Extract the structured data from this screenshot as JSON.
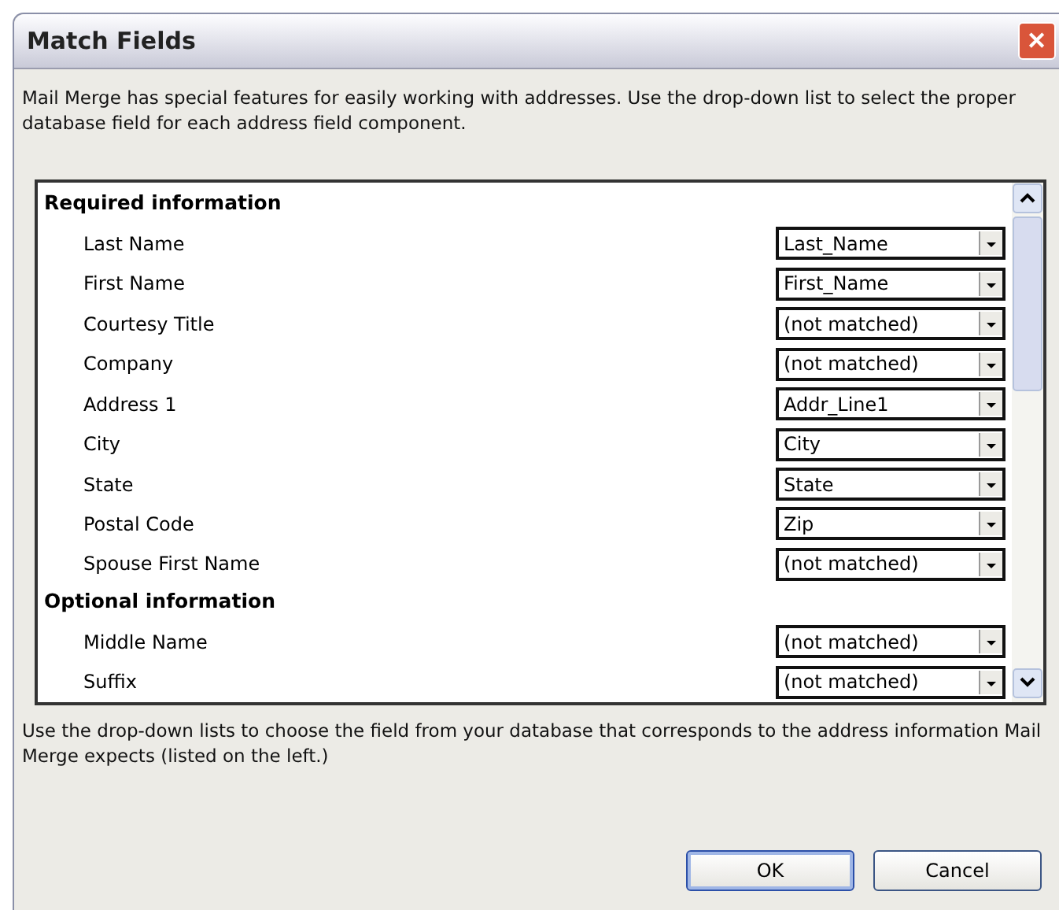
{
  "window": {
    "title": "Match Fields",
    "close": "✕"
  },
  "intro": "Mail Merge has special features for easily working with addresses.  Use the drop-down list to select the proper database field for each address field component.",
  "sections": [
    {
      "title": "Required information",
      "fields": [
        {
          "label": "Last Name",
          "value": "Last_Name"
        },
        {
          "label": "First Name",
          "value": "First_Name"
        },
        {
          "label": "Courtesy Title",
          "value": "(not matched)"
        },
        {
          "label": "Company",
          "value": "(not matched)"
        },
        {
          "label": "Address 1",
          "value": "Addr_Line1"
        },
        {
          "label": "City",
          "value": "City"
        },
        {
          "label": "State",
          "value": "State"
        },
        {
          "label": "Postal Code",
          "value": "Zip"
        },
        {
          "label": "Spouse First Name",
          "value": "(not matched)"
        }
      ]
    },
    {
      "title": "Optional information",
      "fields": [
        {
          "label": "Middle Name",
          "value": "(not matched)"
        },
        {
          "label": "Suffix",
          "value": "(not matched)"
        }
      ]
    }
  ],
  "footer_text": "Use the drop-down lists to choose the field from your database that corresponds to the address information Mail Merge expects (listed on the left.)",
  "buttons": [
    {
      "label": "OK",
      "default": true
    },
    {
      "label": "Cancel",
      "default": false
    }
  ]
}
